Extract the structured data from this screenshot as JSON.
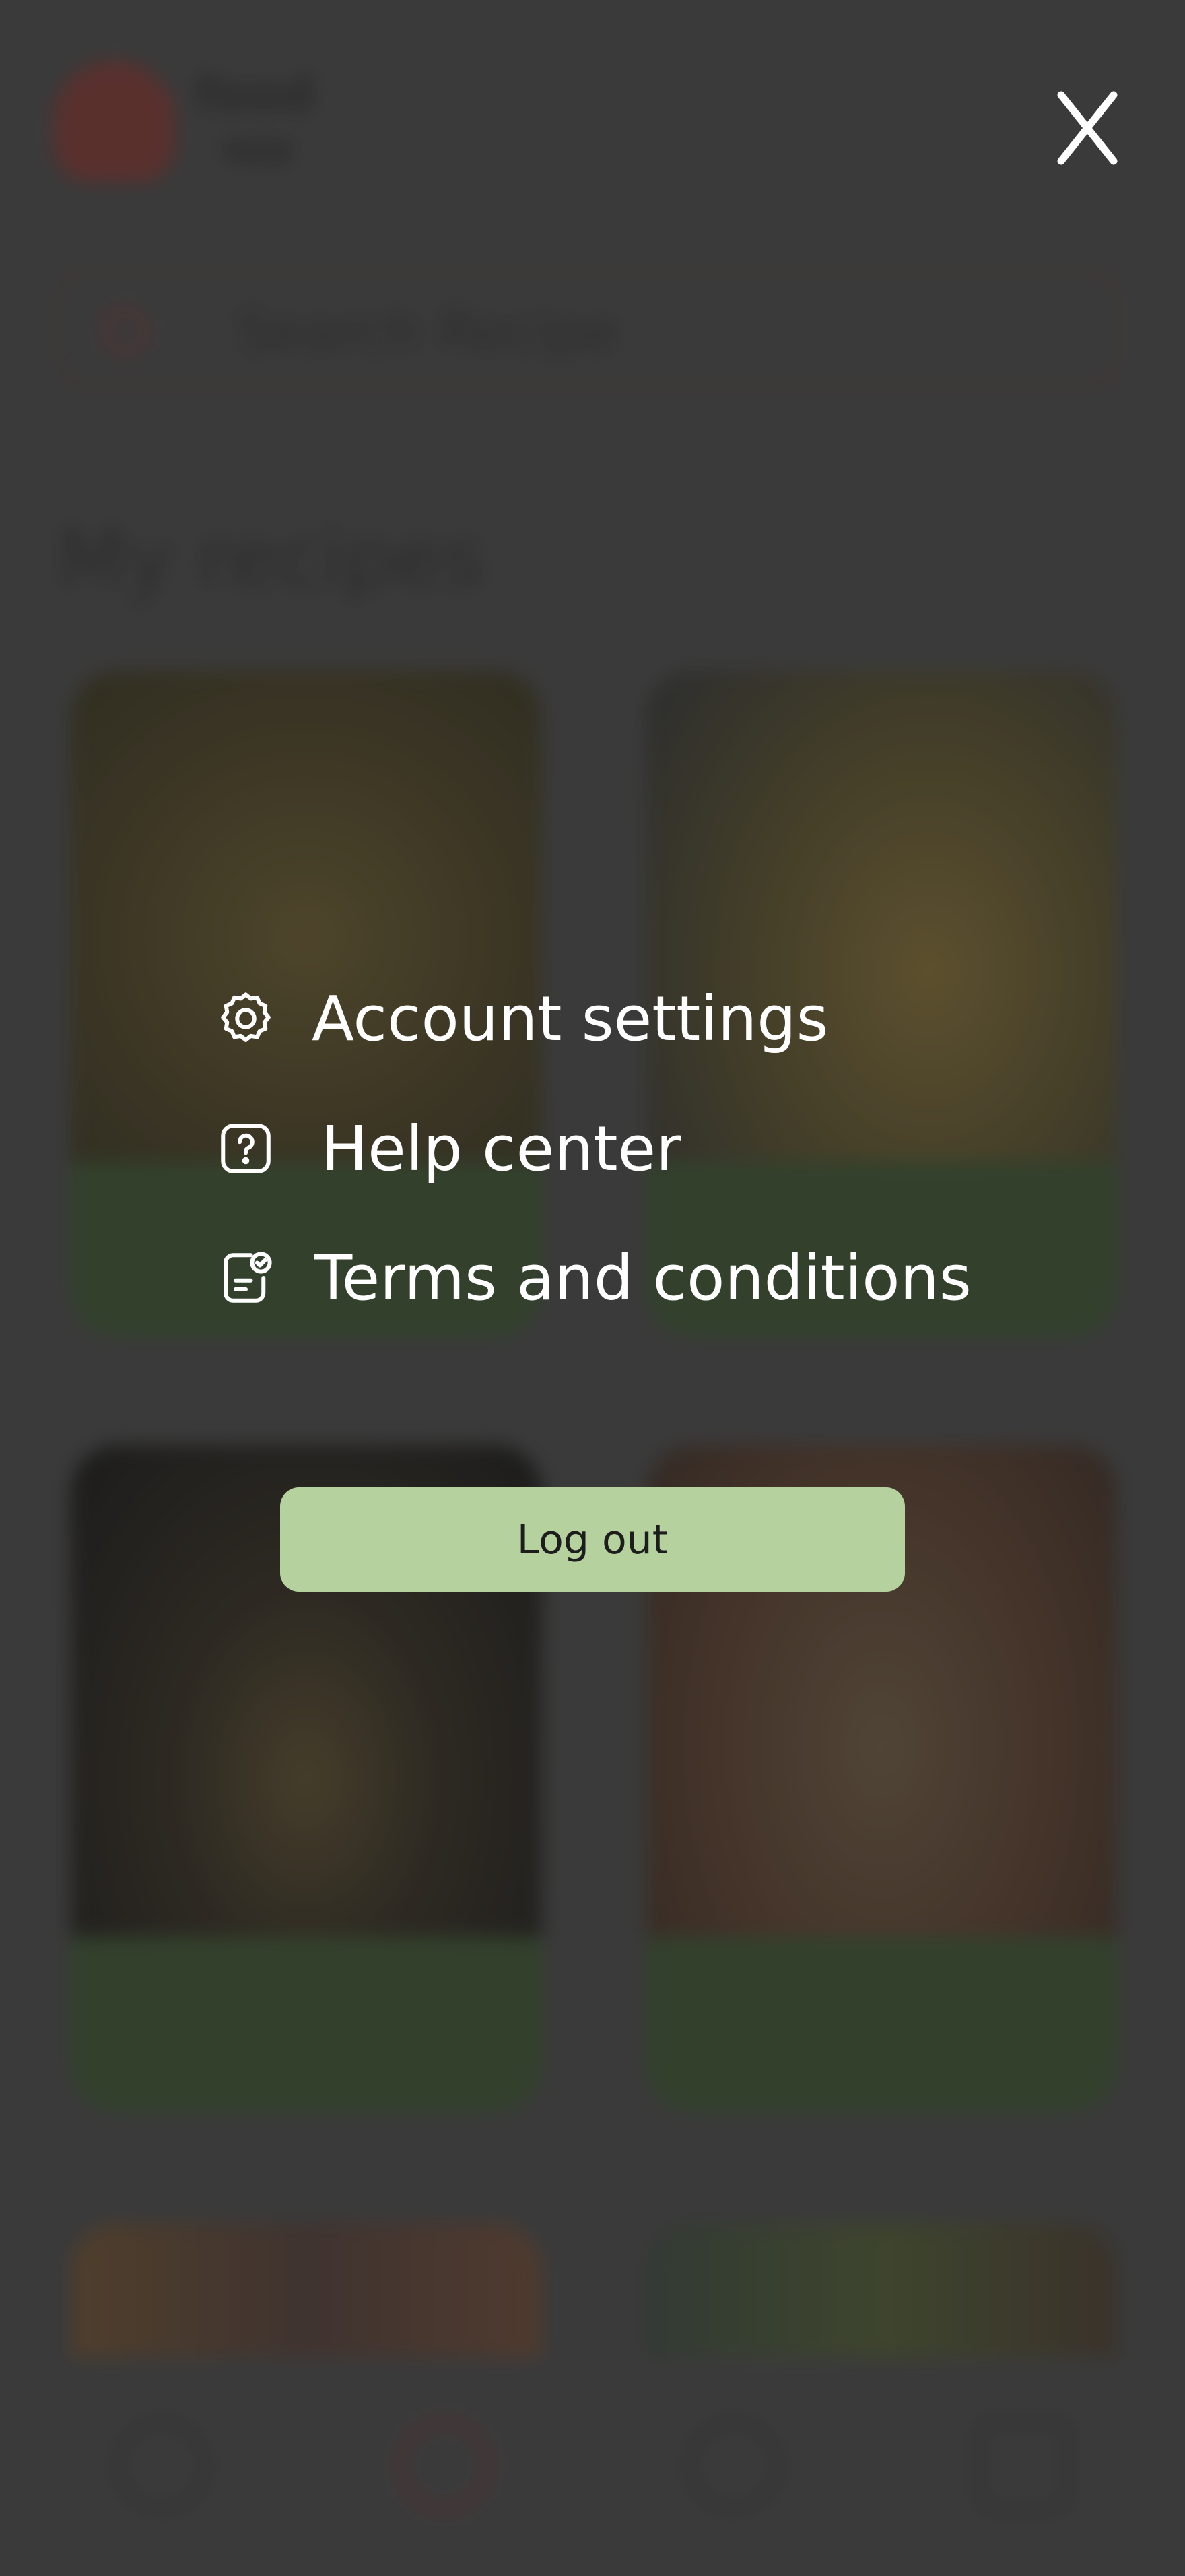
{
  "background": {
    "app_name_line1": "food",
    "app_name_line2": "app",
    "search_placeholder": "Search Recipe",
    "section_title": "My recipes"
  },
  "menu": {
    "items": [
      {
        "label": "Account settings",
        "icon": "gear-icon"
      },
      {
        "label": "Help center",
        "icon": "question-icon"
      },
      {
        "label": "Terms and conditions",
        "icon": "document-check-icon"
      }
    ],
    "logout_label": "Log out",
    "close_icon": "close-icon"
  },
  "colors": {
    "overlay": "#3a3a3a",
    "menu_text": "#ffffff",
    "logout_button": "#b5d29e",
    "logout_text": "#1d1d1d"
  }
}
